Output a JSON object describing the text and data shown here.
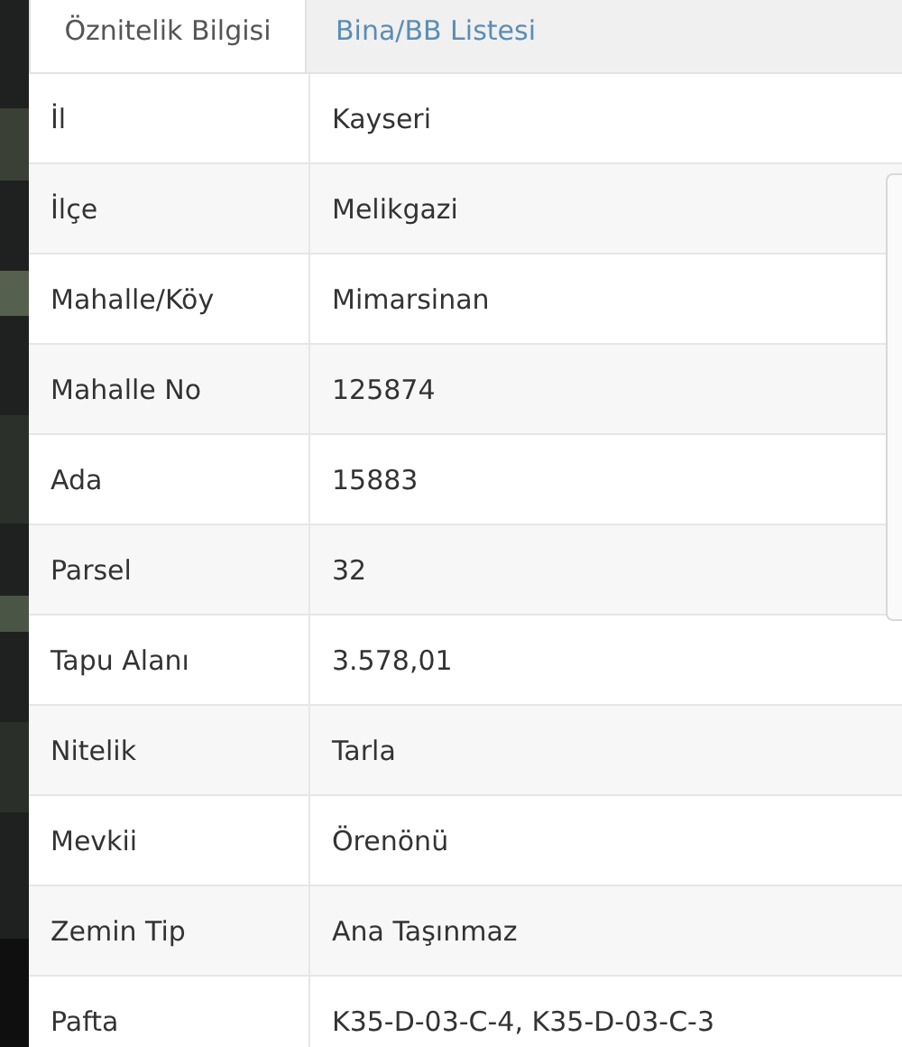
{
  "tabs": [
    {
      "label": "Öznitelik Bilgisi",
      "selected": true
    },
    {
      "label": "Bina/BB Listesi",
      "selected": false
    }
  ],
  "rows": [
    {
      "label": "İl",
      "value": "Kayseri"
    },
    {
      "label": "İlçe",
      "value": "Melikgazi"
    },
    {
      "label": "Mahalle/Köy",
      "value": "Mimarsinan"
    },
    {
      "label": "Mahalle No",
      "value": "125874"
    },
    {
      "label": "Ada",
      "value": "15883"
    },
    {
      "label": "Parsel",
      "value": "32"
    },
    {
      "label": "Tapu Alanı",
      "value": "3.578,01"
    },
    {
      "label": "Nitelik",
      "value": "Tarla"
    },
    {
      "label": "Mevkii",
      "value": "Örenönü"
    },
    {
      "label": "Zemin Tip",
      "value": "Ana Taşınmaz"
    },
    {
      "label": "Pafta",
      "value": "K35-D-03-C-4, K35-D-03-C-3"
    }
  ]
}
